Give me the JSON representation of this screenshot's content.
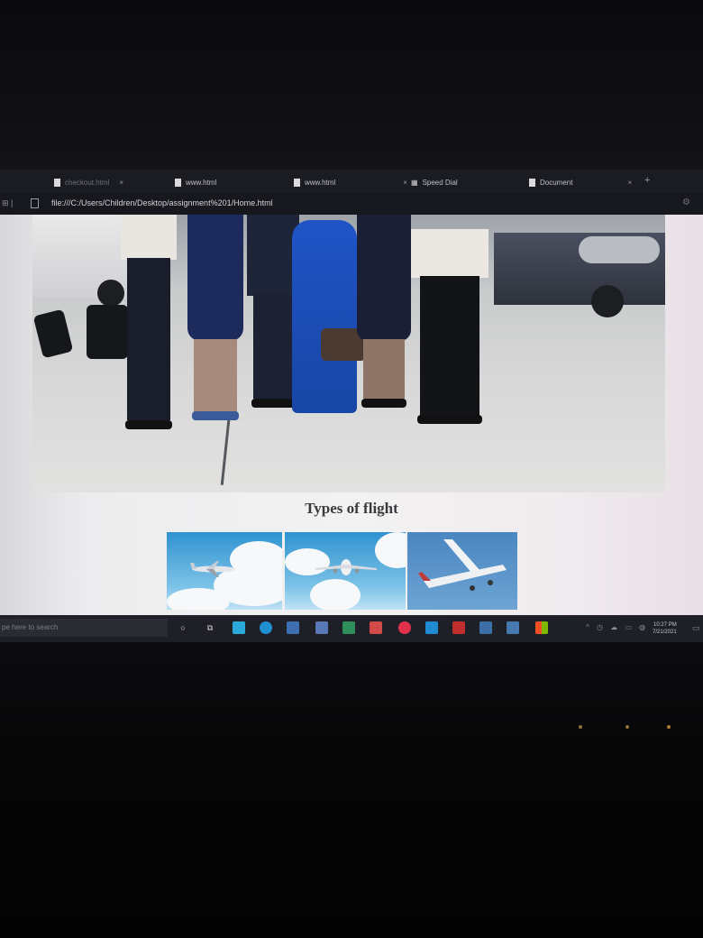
{
  "tabs": [
    {
      "label": "checkout.html",
      "faded": true
    },
    {
      "label": "www.html",
      "faded": false
    },
    {
      "label": "www.html",
      "faded": false
    },
    {
      "label": "Speed Dial",
      "faded": false
    },
    {
      "label": "Document",
      "faded": false
    }
  ],
  "address_bar": {
    "url": "file:///C:/Users/Children/Desktop/assignment%201/Home.html"
  },
  "page": {
    "hero_image": "group photo of airline crew on airport apron",
    "heading": "Types of flight",
    "thumbnails": [
      {
        "depicts": "jet airliner among clouds"
      },
      {
        "depicts": "passenger jet in blue sky"
      },
      {
        "depicts": "small propeller airplane"
      }
    ]
  },
  "taskbar": {
    "search_placeholder": "pe here to search",
    "clock_time": "10:27 PM",
    "clock_date": "7/21/2021"
  },
  "colors": {
    "browser_chrome": "#1b1c22",
    "taskbar": "#1f2027",
    "page_background": "#f3f2f2",
    "sky": "#2f93cf"
  }
}
